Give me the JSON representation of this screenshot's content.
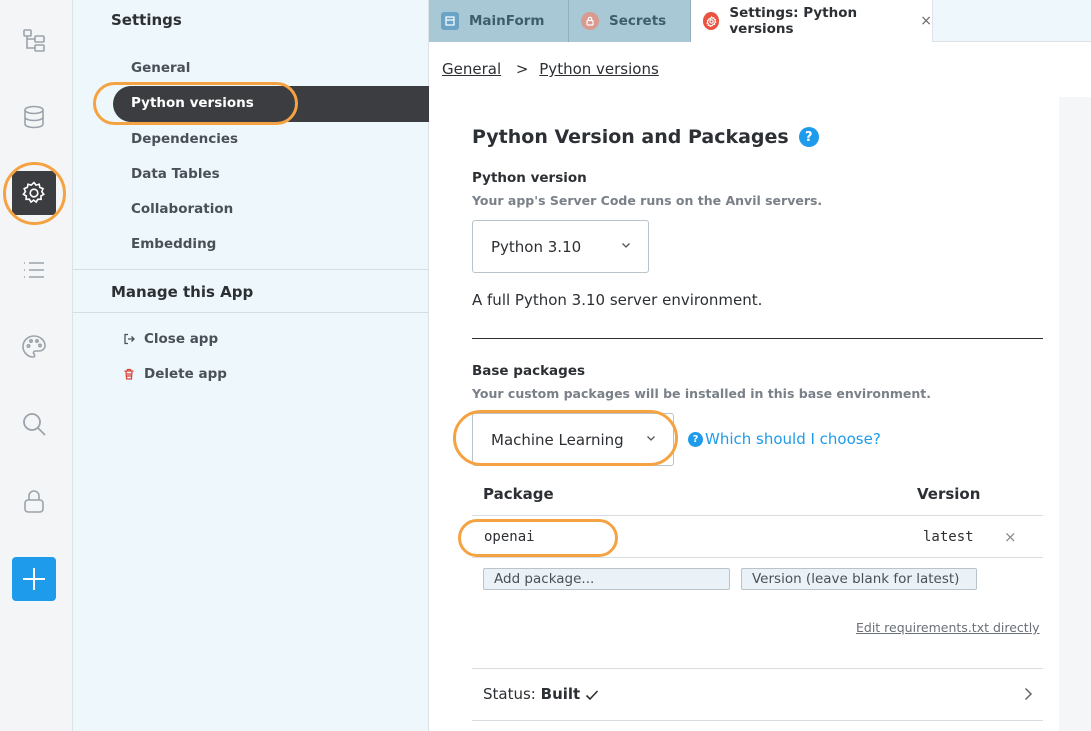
{
  "rail": {
    "icons": [
      "app-tree-icon",
      "database-icon",
      "gear-icon",
      "list-icon",
      "palette-icon",
      "search-icon",
      "lock-icon",
      "plus-icon"
    ]
  },
  "sidebar": {
    "title": "Settings",
    "items": [
      {
        "label": "General"
      },
      {
        "label": "Python versions"
      },
      {
        "label": "Dependencies"
      },
      {
        "label": "Data Tables"
      },
      {
        "label": "Collaboration"
      },
      {
        "label": "Embedding"
      }
    ],
    "manage_title": "Manage this App",
    "actions": [
      {
        "label": "Close app",
        "icon": "exit-icon"
      },
      {
        "label": "Delete app",
        "icon": "trash-icon"
      }
    ]
  },
  "tabs": [
    {
      "label": "MainForm",
      "icon": "form-icon"
    },
    {
      "label": "Secrets",
      "icon": "lock-icon"
    },
    {
      "label": "Settings: Python versions",
      "icon": "gear-icon",
      "close": "×"
    }
  ],
  "breadcrumb": {
    "root": "General",
    "separator": ">",
    "current": "Python versions"
  },
  "main": {
    "title": "Python Version and Packages",
    "help": "?",
    "python_version": {
      "label": "Python version",
      "hint": "Your app's Server Code runs on the Anvil servers.",
      "selected": "Python 3.10",
      "description": "A full Python 3.10 server environment."
    },
    "base_packages": {
      "label": "Base packages",
      "hint": "Your custom packages will be installed in this base environment.",
      "selected": "Machine Learning",
      "which_link": "Which should I choose?",
      "which_icon": "?"
    },
    "packages_table": {
      "col_package": "Package",
      "col_version": "Version",
      "rows": [
        {
          "package": "openai",
          "version": "latest",
          "remove": "×"
        }
      ],
      "add_package_placeholder": "Add package...",
      "add_version_placeholder": "Version (leave blank for latest)"
    },
    "edit_requirements": "Edit requirements.txt directly",
    "status": {
      "prefix": "Status:",
      "value": "Built"
    }
  },
  "colors": {
    "accent": "#1e9bea",
    "highlight_ring": "#f5a342",
    "sidebar_bg": "#eef7fb",
    "active_item": "#3b3d40"
  }
}
